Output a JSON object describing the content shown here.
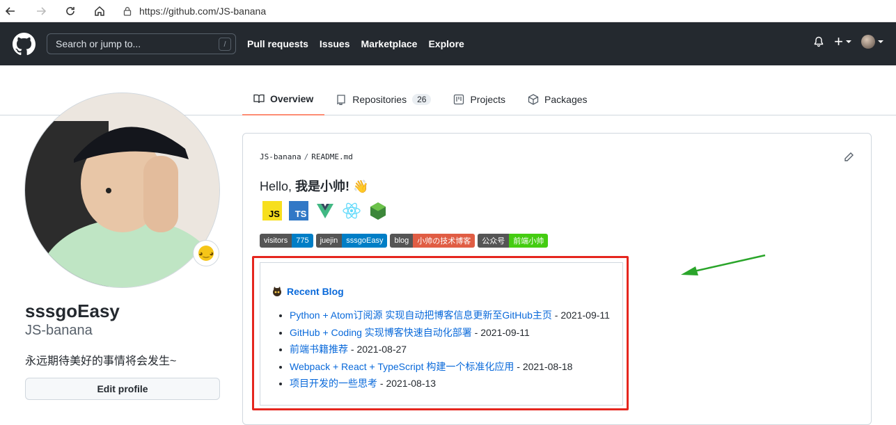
{
  "browser": {
    "url": "https://github.com/JS-banana"
  },
  "header": {
    "search_placeholder": "Search or jump to...",
    "search_shortcut": "/",
    "nav": [
      "Pull requests",
      "Issues",
      "Marketplace",
      "Explore"
    ],
    "plus_label": "+"
  },
  "tabs": [
    {
      "label": "Overview",
      "active": true
    },
    {
      "label": "Repositories",
      "count": "26"
    },
    {
      "label": "Projects"
    },
    {
      "label": "Packages"
    }
  ],
  "profile": {
    "name": "sssgoEasy",
    "login": "JS-banana",
    "bio": "永远期待美好的事情将会发生~",
    "edit_button": "Edit profile"
  },
  "readme": {
    "owner": "JS-banana",
    "file": "README.md",
    "hello_prefix": "Hello, ",
    "hello_bold": "我是小帅! ",
    "hello_emoji": "👋",
    "tech_logos": [
      "JS",
      "TS",
      "vue-logo",
      "react-logo",
      "nodejs-logo"
    ],
    "badges": [
      {
        "label": "visitors",
        "value": "775",
        "color": "#007ec6"
      },
      {
        "label": "juejin",
        "value": "sssgoEasy",
        "color": "#007ec6"
      },
      {
        "label": "blog",
        "value": "小帅の技术博客",
        "color": "#e05d44"
      },
      {
        "label": "公众号",
        "value": "前端小帅",
        "color": "#4c1"
      }
    ],
    "recent_blog": {
      "title": "Recent Blog",
      "items": [
        {
          "title": "Python + Atom订阅源 实现自动把博客信息更新至GitHub主页",
          "date": " - 2021-09-11"
        },
        {
          "title": "GitHub + Coding 实现博客快速自动化部署",
          "date": " - 2021-09-11"
        },
        {
          "title": "前端书籍推荐",
          "date": " - 2021-08-27"
        },
        {
          "title": "Webpack + React + TypeScript 构建一个标准化应用",
          "date": " - 2021-08-18"
        },
        {
          "title": "项目开发的一些思考",
          "date": " - 2021-08-13"
        }
      ]
    }
  },
  "annotation_colors": {
    "highlight": "#e5261e",
    "arrow": "#2aa52a"
  }
}
